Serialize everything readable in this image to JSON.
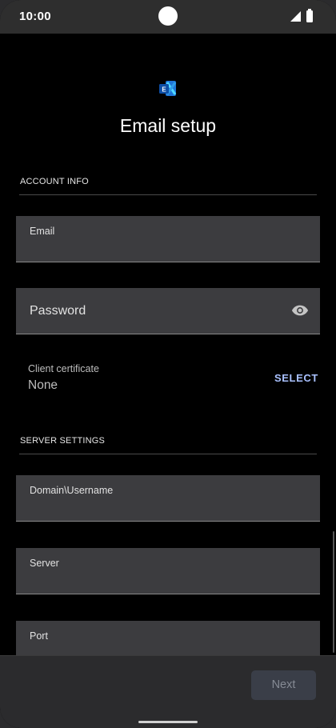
{
  "status_bar": {
    "time": "10:00"
  },
  "header": {
    "title": "Email setup"
  },
  "account_info": {
    "section_label": "ACCOUNT INFO",
    "email_label": "Email",
    "password_label": "Password",
    "client_certificate_label": "Client certificate",
    "client_certificate_value": "None",
    "select_label": "SELECT"
  },
  "server_settings": {
    "section_label": "SERVER SETTINGS",
    "domain_username_label": "Domain\\Username",
    "server_label": "Server",
    "port_label": "Port"
  },
  "footer": {
    "next_label": "Next"
  },
  "colors": {
    "background": "#000000",
    "field_background": "#3c3c3f",
    "accent": "#a9c1ff",
    "next_button_disabled": "#3a3e48"
  },
  "icons": {
    "app_logo": "exchange-logo-icon",
    "password_toggle": "eye-icon",
    "signal": "signal-icon",
    "battery": "battery-icon"
  }
}
